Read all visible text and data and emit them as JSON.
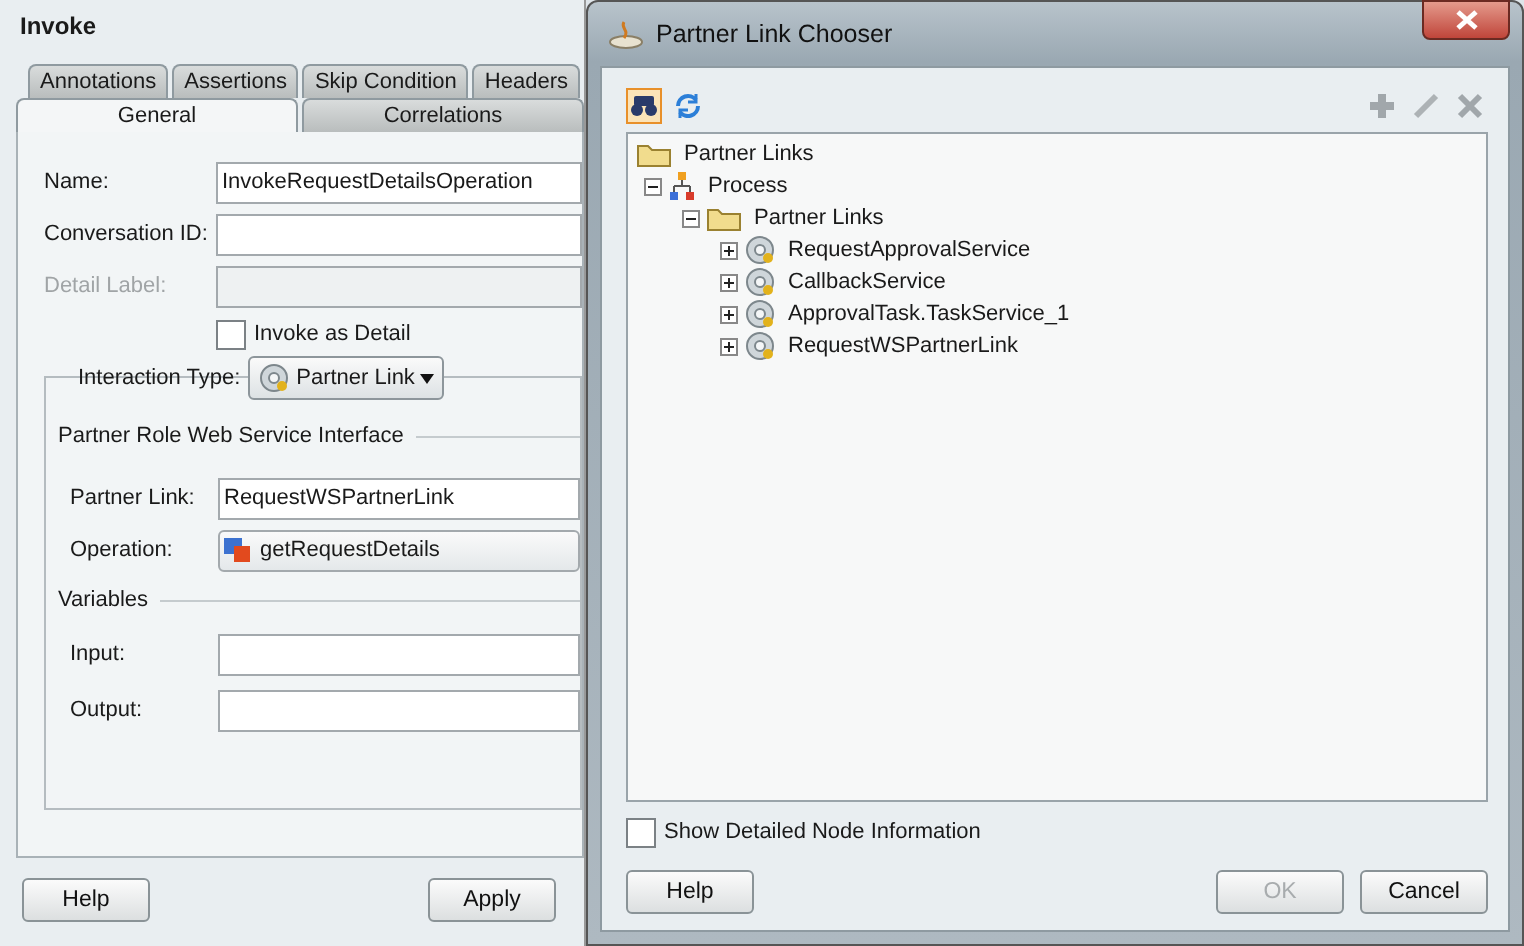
{
  "invoke_dialog": {
    "title": "Invoke",
    "tabs": [
      [
        {
          "label": "Annotations",
          "selected": false
        },
        {
          "label": "Assertions",
          "selected": false
        },
        {
          "label": "Skip Condition",
          "selected": false
        },
        {
          "label": "Headers",
          "selected": false
        }
      ],
      [
        {
          "label": "General",
          "selected": true
        },
        {
          "label": "Correlations",
          "selected": false
        }
      ]
    ],
    "fields": [
      {
        "kind": "text",
        "label": "Name:",
        "value": "InvokeRequestDetailsOperation",
        "disabled": false
      },
      {
        "kind": "text",
        "label": "Conversation ID:",
        "disabled": false
      },
      {
        "kind": "text",
        "label": "Detail Label:",
        "disabled": true
      },
      {
        "kind": "checkbox",
        "label": "Invoke as Detail",
        "checked": false
      }
    ],
    "interaction_type": {
      "label": "Interaction Type:",
      "value": "Partner Link"
    },
    "interface_section": {
      "title": "Partner Role Web Service Interface",
      "fields": [
        {
          "kind": "text",
          "label": "Partner Link:",
          "value": "RequestWSPartnerLink"
        },
        {
          "kind": "dropdown",
          "label": "Operation:",
          "value": "getRequestDetails"
        }
      ]
    },
    "variables_section": {
      "title": "Variables",
      "fields": [
        {
          "kind": "text",
          "label": "Input:"
        },
        {
          "kind": "text",
          "label": "Output:"
        }
      ]
    },
    "buttons": [
      {
        "label": "Help",
        "disabled": false
      },
      {
        "label": "Apply",
        "disabled": false
      }
    ]
  },
  "chooser_dialog": {
    "title": "Partner Link Chooser",
    "toolbar_left": [
      {
        "kind": "find",
        "selected": true
      },
      {
        "kind": "refresh",
        "selected": false
      }
    ],
    "toolbar_right": [
      {
        "kind": "add",
        "disabled": true
      },
      {
        "kind": "edit",
        "disabled": true
      },
      {
        "kind": "delete",
        "disabled": true
      }
    ],
    "tree": [
      {
        "label": "Partner Links",
        "kind": "folder",
        "children": [
          {
            "label": "Process",
            "kind": "process",
            "expanded": true,
            "children": [
              {
                "label": "Partner Links",
                "kind": "folder",
                "expanded": true,
                "children": [
                  {
                    "label": "RequestApprovalService",
                    "kind": "service",
                    "expanded": false
                  },
                  {
                    "label": "CallbackService",
                    "kind": "service",
                    "expanded": false
                  },
                  {
                    "label": "ApprovalTask.TaskService_1",
                    "kind": "service",
                    "expanded": false
                  },
                  {
                    "label": "RequestWSPartnerLink",
                    "kind": "service",
                    "expanded": false
                  }
                ]
              }
            ]
          }
        ]
      }
    ],
    "show_details": {
      "label": "Show Detailed Node Information",
      "checked": false
    },
    "buttons": [
      {
        "label": "Help",
        "disabled": false
      },
      {
        "label": "OK",
        "disabled": true
      },
      {
        "label": "Cancel",
        "disabled": false
      }
    ]
  }
}
